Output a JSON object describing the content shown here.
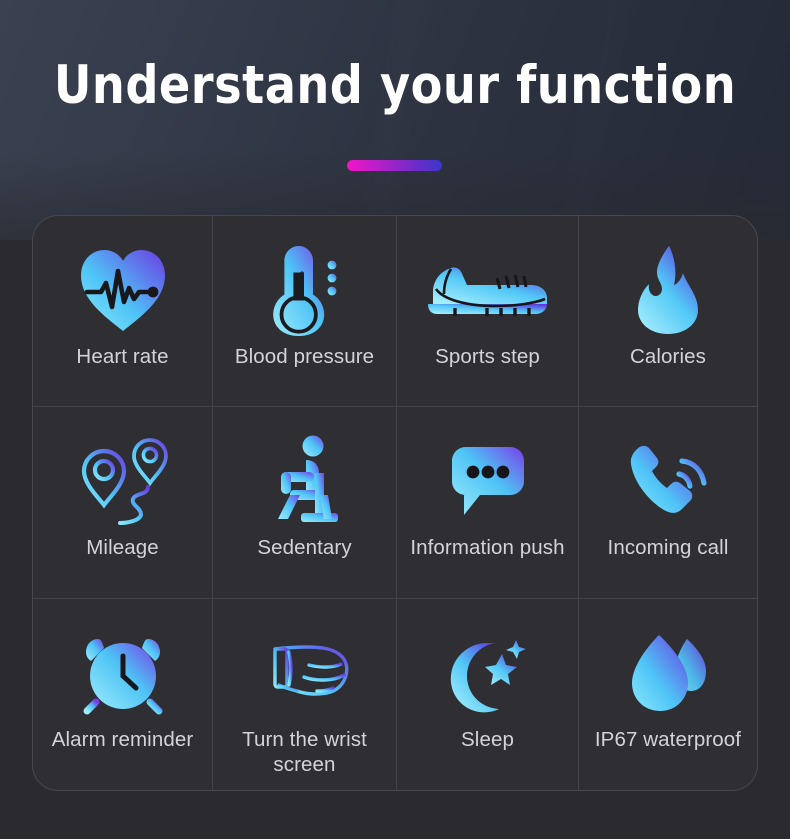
{
  "header": {
    "title": "Understand your function",
    "accent_gradient_from": "#f315c8",
    "accent_gradient_to": "#3b36c9"
  },
  "theme": {
    "page_bg_top": "#363d4b",
    "page_bg_bottom": "#2b2b2f",
    "panel_bg": "#2e2e33",
    "divider": "#5a5a63",
    "label_color": "#d3d3d8",
    "icon_gradient_from": "#7ee3f8",
    "icon_gradient_to": "#6a3ce2"
  },
  "grid": {
    "columns": 4,
    "rows": 3,
    "cells": [
      {
        "label": "Heart rate",
        "icon": "heart-rate-icon",
        "lines": 1
      },
      {
        "label": "Blood pressure",
        "icon": "thermometer-icon",
        "lines": 2
      },
      {
        "label": "Sports step",
        "icon": "sport-shoe-icon",
        "lines": 1
      },
      {
        "label": "Calories",
        "icon": "flame-icon",
        "lines": 1
      },
      {
        "label": "Mileage",
        "icon": "map-pin-route-icon",
        "lines": 1
      },
      {
        "label": "Sedentary",
        "icon": "sitting-person-icon",
        "lines": 1
      },
      {
        "label": "Information push",
        "icon": "chat-bubble-icon",
        "lines": 2
      },
      {
        "label": "Incoming call",
        "icon": "phone-ringing-icon",
        "lines": 2
      },
      {
        "label": "Alarm reminder",
        "icon": "alarm-clock-icon",
        "lines": 2
      },
      {
        "label": "Turn the wrist screen",
        "icon": "wrist-watch-hand-icon",
        "lines": 2
      },
      {
        "label": "Sleep",
        "icon": "moon-stars-icon",
        "lines": 1
      },
      {
        "label": "IP67 waterproof",
        "icon": "water-drops-icon",
        "lines": 2
      }
    ]
  }
}
